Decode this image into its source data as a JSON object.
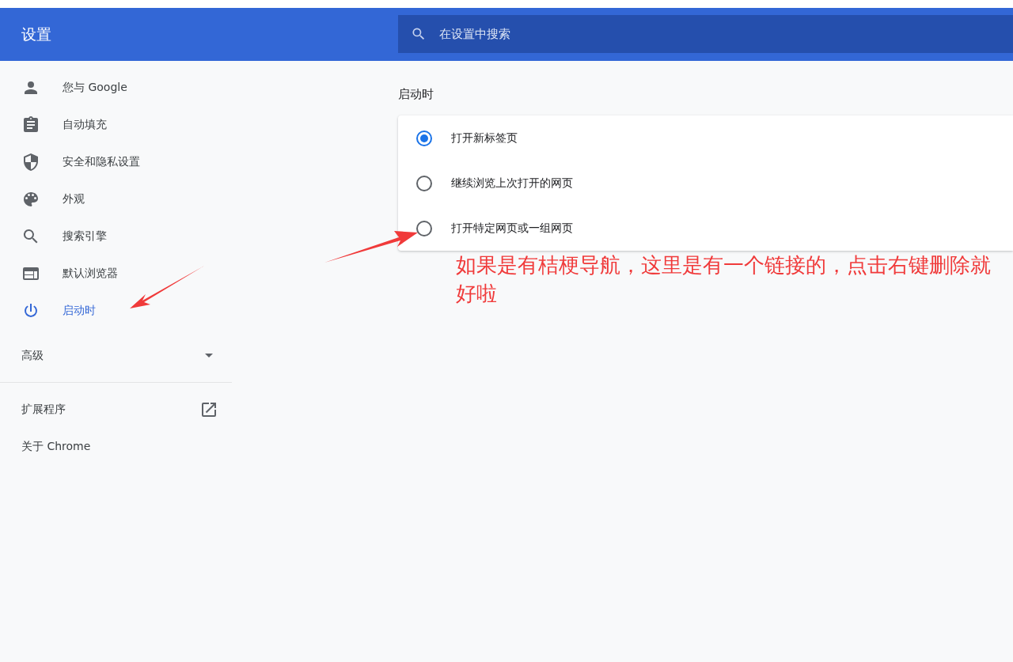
{
  "header": {
    "title": "设置",
    "search": {
      "placeholder": "在设置中搜索"
    }
  },
  "sidebar": {
    "items": [
      {
        "label": "您与 Google",
        "selected": false
      },
      {
        "label": "自动填充",
        "selected": false
      },
      {
        "label": "安全和隐私设置",
        "selected": false
      },
      {
        "label": "外观",
        "selected": false
      },
      {
        "label": "搜索引擎",
        "selected": false
      },
      {
        "label": "默认浏览器",
        "selected": false
      },
      {
        "label": "启动时",
        "selected": true
      }
    ],
    "advanced": {
      "label": "高级",
      "expanded": false
    },
    "links": [
      {
        "label": "扩展程序",
        "external": true
      },
      {
        "label": "关于 Chrome",
        "external": false
      }
    ]
  },
  "section": {
    "title": "启动时",
    "options": [
      {
        "label": "打开新标签页",
        "selected": true
      },
      {
        "label": "继续浏览上次打开的网页",
        "selected": false
      },
      {
        "label": "打开特定网页或一组网页",
        "selected": false
      }
    ]
  },
  "annotation": {
    "text": "如果是有桔梗导航，这里是有一个链接的，点击右键删除就好啦"
  }
}
